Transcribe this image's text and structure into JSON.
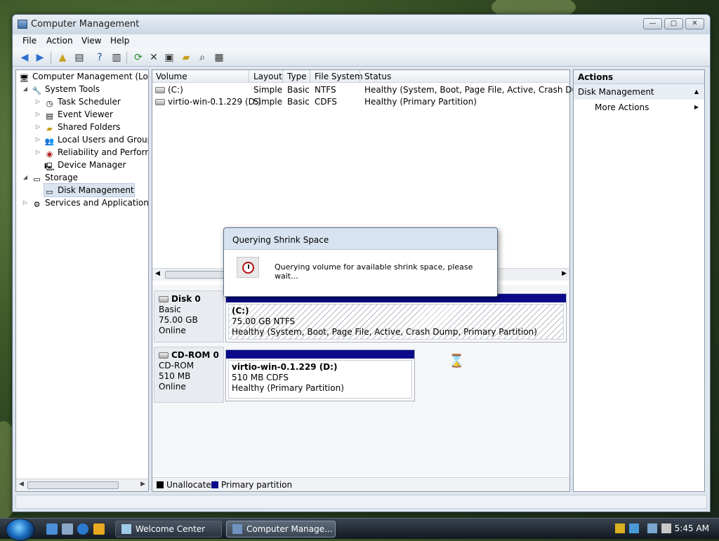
{
  "window": {
    "title": "Computer Management",
    "controls": {
      "minimize": "—",
      "maximize": "▢",
      "close": "✕"
    }
  },
  "menu": [
    "File",
    "Action",
    "View",
    "Help"
  ],
  "tree": {
    "items": [
      {
        "label": "Computer Management (Local",
        "icon": "computer-icon"
      },
      {
        "label": "System Tools",
        "icon": "tools-icon"
      },
      {
        "label": "Task Scheduler",
        "icon": "clock-icon"
      },
      {
        "label": "Event Viewer",
        "icon": "event-viewer-icon"
      },
      {
        "label": "Shared Folders",
        "icon": "shared-folder-icon"
      },
      {
        "label": "Local Users and Groups",
        "icon": "users-icon"
      },
      {
        "label": "Reliability and Performa",
        "icon": "performance-icon"
      },
      {
        "label": "Device Manager",
        "icon": "device-manager-icon"
      },
      {
        "label": "Storage",
        "icon": "storage-icon"
      },
      {
        "label": "Disk Management",
        "icon": "disk-icon"
      },
      {
        "label": "Services and Applications",
        "icon": "services-icon"
      }
    ]
  },
  "volumes": {
    "headers": [
      "Volume",
      "Layout",
      "Type",
      "File System",
      "Status"
    ],
    "rows": [
      {
        "volume": "(C:)",
        "layout": "Simple",
        "type": "Basic",
        "fs": "NTFS",
        "status": "Healthy (System, Boot, Page File, Active, Crash Dump, P"
      },
      {
        "volume": "virtio-win-0.1.229 (D:)",
        "layout": "Simple",
        "type": "Basic",
        "fs": "CDFS",
        "status": "Healthy (Primary Partition)"
      }
    ]
  },
  "disks": [
    {
      "name": "Disk 0",
      "kind": "Basic",
      "size": "75.00 GB",
      "state": "Online",
      "partition": {
        "name": "(C:)",
        "size_fs": "75.00 GB NTFS",
        "status": "Healthy (System, Boot, Page File, Active, Crash Dump, Primary Partition)"
      }
    },
    {
      "name": "CD-ROM 0",
      "kind": "CD-ROM",
      "size": "510 MB",
      "state": "Online",
      "partition": {
        "name": "virtio-win-0.1.229  (D:)",
        "size_fs": "510 MB CDFS",
        "status": "Healthy (Primary Partition)"
      }
    }
  ],
  "legend": {
    "unallocated": "Unallocated",
    "primary": "Primary partition"
  },
  "actions": {
    "header": "Actions",
    "section": "Disk Management",
    "more": "More Actions"
  },
  "dialog": {
    "title": "Querying Shrink Space",
    "message": "Querying volume for available shrink space, please wait..."
  },
  "taskbar": {
    "buttons": [
      "Welcome Center",
      "Computer Manage..."
    ],
    "clock": "5:45 AM"
  },
  "colors": {
    "partition_bar": "#0a0a8a",
    "unallocated": "#000000"
  }
}
